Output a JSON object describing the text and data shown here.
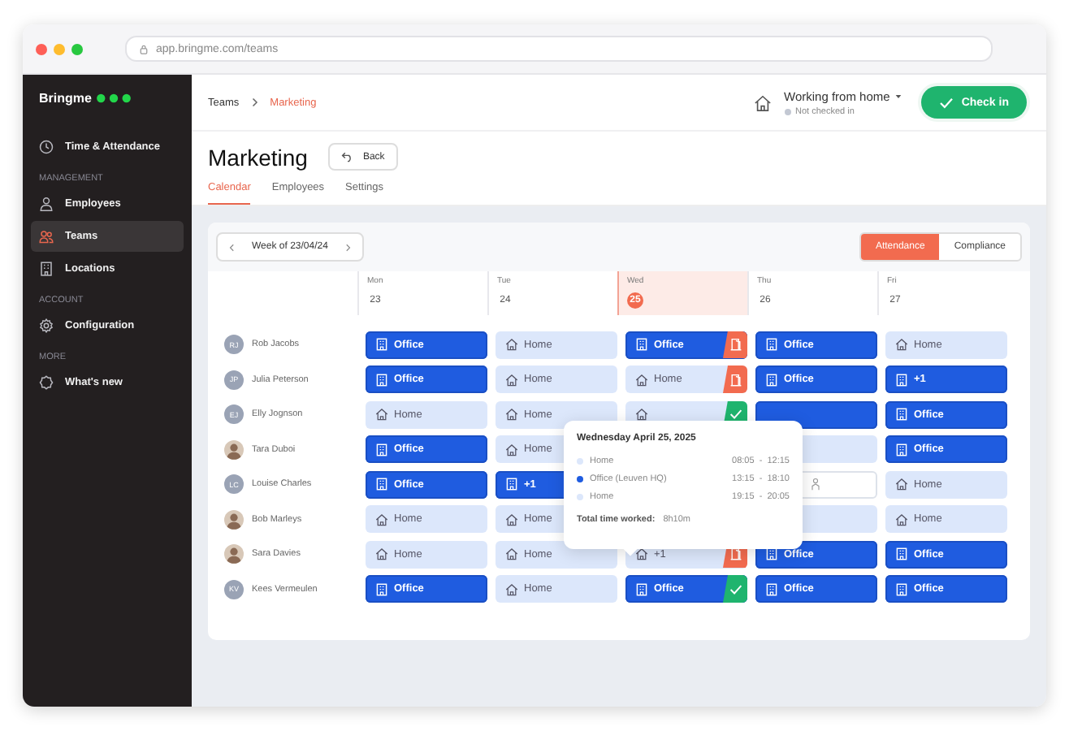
{
  "browser": {
    "url": "app.bringme.com/teams"
  },
  "sidebar": {
    "brand": "Bringme",
    "sections": [
      {
        "items": [
          {
            "label": "Time & Attendance",
            "selected": false
          }
        ]
      },
      {
        "title": "MANAGEMENT",
        "items": [
          {
            "label": "Employees",
            "selected": false
          },
          {
            "label": "Teams",
            "selected": true
          },
          {
            "label": "Locations",
            "selected": false
          }
        ]
      },
      {
        "title": "ACCOUNT",
        "items": [
          {
            "label": "Configuration",
            "selected": false
          }
        ]
      },
      {
        "title": "MORE",
        "items": [
          {
            "label": "What's new",
            "selected": false
          }
        ]
      }
    ]
  },
  "breadcrumb": [
    "Teams",
    "Marketing"
  ],
  "status": {
    "label": "Working from home",
    "sub": "Not checked in",
    "button": "Check in"
  },
  "page": {
    "title": "Marketing",
    "back": "Back"
  },
  "tabs": [
    {
      "label": "Calendar",
      "selected": true
    },
    {
      "label": "Employees",
      "selected": false
    },
    {
      "label": "Settings",
      "selected": false
    }
  ],
  "week": "Week of 23/04/24",
  "views": [
    {
      "label": "Attendance",
      "selected": true
    },
    {
      "label": "Compliance",
      "selected": false
    }
  ],
  "days": [
    {
      "name": "Mon",
      "date": "23",
      "today": false
    },
    {
      "name": "Tue",
      "date": "24",
      "today": false
    },
    {
      "name": "Wed",
      "date": "25",
      "today": true
    },
    {
      "name": "Thu",
      "date": "26",
      "today": false
    },
    {
      "name": "Fri",
      "date": "27",
      "today": false
    }
  ],
  "rows": [
    {
      "name": "Rob Jacobs",
      "initials": "RJ",
      "cells": [
        {
          "kind": "office",
          "label": "Office"
        },
        {
          "kind": "home",
          "label": "Home"
        },
        {
          "kind": "office",
          "label": "Office",
          "badge": {
            "kind": "door"
          }
        },
        {
          "kind": "office",
          "label": "Office"
        },
        {
          "kind": "home",
          "label": "Home"
        }
      ]
    },
    {
      "name": "Julia Peterson",
      "initials": "JP",
      "cells": [
        {
          "kind": "office",
          "label": "Office"
        },
        {
          "kind": "home",
          "label": "Home"
        },
        {
          "kind": "home",
          "label": "Home",
          "badge": {
            "kind": "door"
          }
        },
        {
          "kind": "office",
          "label": "Office"
        },
        {
          "kind": "office",
          "label": "+1"
        }
      ]
    },
    {
      "name": "Elly Jognson",
      "initials": "EJ",
      "cells": [
        {
          "kind": "home",
          "label": "Home"
        },
        {
          "kind": "home",
          "label": "Home"
        },
        {
          "kind": "home",
          "badge": {
            "kind": "check"
          }
        },
        {
          "kind": "office"
        },
        {
          "kind": "office",
          "label": "Office"
        }
      ]
    },
    {
      "name": "Tara Duboi",
      "cells": [
        {
          "kind": "office",
          "label": "Office"
        },
        {
          "kind": "home",
          "label": "Home"
        },
        null,
        {
          "kind": "home"
        },
        {
          "kind": "office",
          "label": "Office"
        }
      ]
    },
    {
      "name": "Louise Charles",
      "initials": "LC",
      "cells": [
        {
          "kind": "office",
          "label": "Office"
        },
        {
          "kind": "office",
          "label": "+1"
        },
        null,
        {
          "kind": "split"
        },
        {
          "kind": "home",
          "label": "Home"
        }
      ]
    },
    {
      "name": "Bob Marleys",
      "cells": [
        {
          "kind": "home",
          "label": "Home"
        },
        {
          "kind": "home",
          "label": "Home"
        },
        null,
        {
          "kind": "home"
        },
        {
          "kind": "home",
          "label": "Home"
        }
      ]
    },
    {
      "name": "Sara Davies",
      "cells": [
        {
          "kind": "home",
          "label": "Home"
        },
        {
          "kind": "home",
          "label": "Home"
        },
        {
          "kind": "home",
          "label": "+1",
          "badge": {
            "kind": "door"
          }
        },
        {
          "kind": "office",
          "label": "Office"
        },
        {
          "kind": "office",
          "label": "Office"
        }
      ]
    },
    {
      "name": "Kees Vermeulen",
      "initials": "KV",
      "cells": [
        {
          "kind": "office",
          "label": "Office"
        },
        {
          "kind": "home",
          "label": "Home"
        },
        {
          "kind": "office",
          "label": "Office",
          "badge": {
            "kind": "check"
          }
        },
        {
          "kind": "office",
          "label": "Office"
        },
        {
          "kind": "office",
          "label": "Office"
        }
      ]
    }
  ],
  "tooltip": {
    "title": "Wednesday April 25, 2025",
    "entries": [
      {
        "kind": "home",
        "place": "Home",
        "time": "08:05  -  12:15"
      },
      {
        "kind": "office",
        "place": "Office (Leuven HQ)",
        "time": "13:15  -  18:10"
      },
      {
        "kind": "home",
        "place": "Home",
        "time": "19:15  -  20:05"
      }
    ],
    "total_label": "Total time worked:",
    "total": "8h10m"
  }
}
